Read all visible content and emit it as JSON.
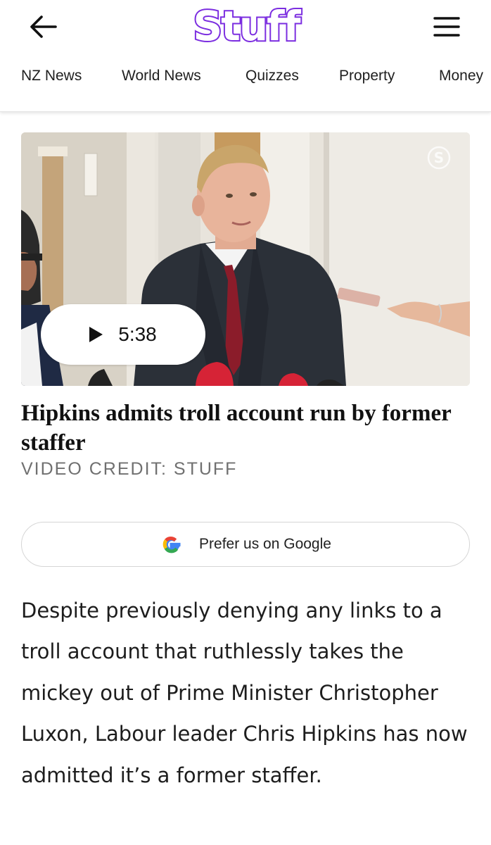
{
  "header": {
    "back_icon": "arrow-left-icon",
    "logo_text": "Stuff",
    "menu_icon": "hamburger-menu-icon",
    "brand_color": "#7b2de0"
  },
  "nav": {
    "items": [
      {
        "label": "NZ News"
      },
      {
        "label": "World News"
      },
      {
        "label": "Quizzes"
      },
      {
        "label": "Property"
      },
      {
        "label": "Money"
      }
    ]
  },
  "hero": {
    "watermark": "S",
    "play_icon": "play-icon",
    "duration": "5:38"
  },
  "article": {
    "headline": "Hipkins admits troll account run by former staffer",
    "credit": "VIDEO CREDIT: STUFF",
    "prefer_button": {
      "icon": "google-g-icon",
      "label": "Prefer us on Google"
    },
    "body": "Despite previously denying any links to a troll account that ruthlessly takes the mickey out of Prime Minister Christopher Luxon, Labour leader Chris Hipkins has now admitted it’s a former staffer."
  }
}
